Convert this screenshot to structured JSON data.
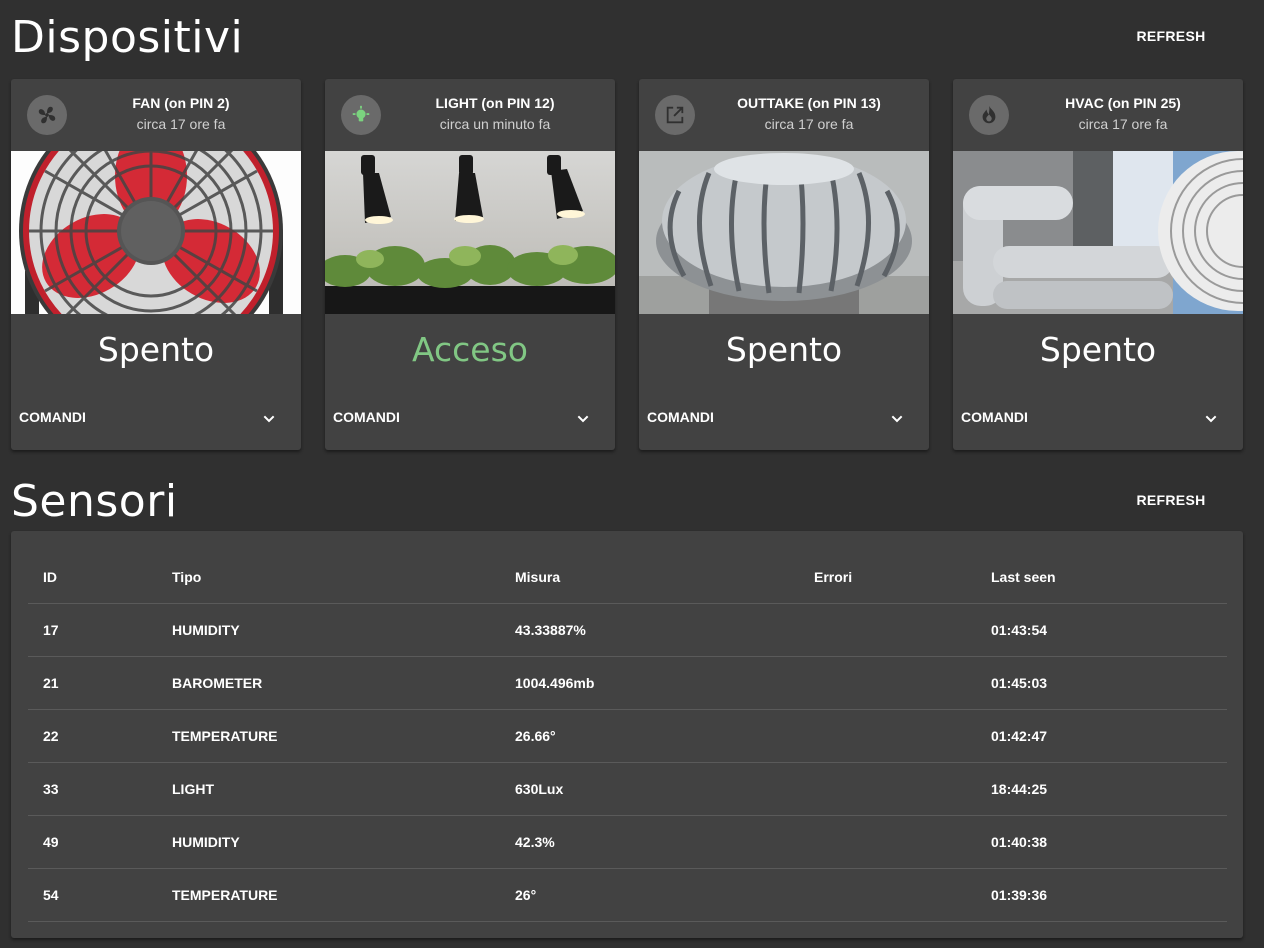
{
  "dispositivi": {
    "title": "Dispositivi",
    "refresh_label": "REFRESH",
    "devices": [
      {
        "title": "FAN (on PIN 2)",
        "subtitle": "circa 17 ore fa",
        "state": "Spento",
        "is_on": false,
        "commands_label": "COMANDI",
        "icon": "fan-icon"
      },
      {
        "title": "LIGHT (on PIN 12)",
        "subtitle": "circa un minuto fa",
        "state": "Acceso",
        "is_on": true,
        "commands_label": "COMANDI",
        "icon": "lightbulb-icon"
      },
      {
        "title": "OUTTAKE (on PIN 13)",
        "subtitle": "circa 17 ore fa",
        "state": "Spento",
        "is_on": false,
        "commands_label": "COMANDI",
        "icon": "open-in-new-icon"
      },
      {
        "title": "HVAC (on PIN 25)",
        "subtitle": "circa 17 ore fa",
        "state": "Spento",
        "is_on": false,
        "commands_label": "COMANDI",
        "icon": "fire-icon"
      }
    ]
  },
  "sensori": {
    "title": "Sensori",
    "refresh_label": "REFRESH",
    "columns": [
      "ID",
      "Tipo",
      "Misura",
      "Errori",
      "Last seen"
    ],
    "rows": [
      [
        "17",
        "HUMIDITY",
        "43.33887%",
        "",
        "01:43:54"
      ],
      [
        "21",
        "BAROMETER",
        "1004.496mb",
        "",
        "01:45:03"
      ],
      [
        "22",
        "TEMPERATURE",
        "26.66°",
        "",
        "01:42:47"
      ],
      [
        "33",
        "LIGHT",
        "630Lux",
        "",
        "18:44:25"
      ],
      [
        "49",
        "HUMIDITY",
        "42.3%",
        "",
        "01:40:38"
      ],
      [
        "54",
        "TEMPERATURE",
        "26°",
        "",
        "01:39:36"
      ]
    ]
  },
  "colors": {
    "background": "#303030",
    "card": "#424242",
    "on_state": "#81c784"
  }
}
